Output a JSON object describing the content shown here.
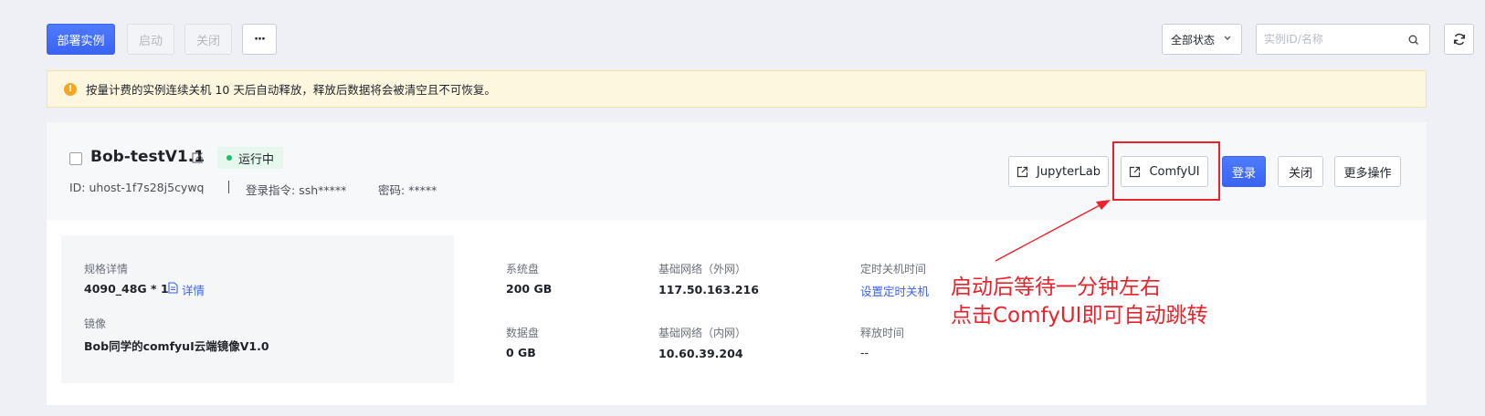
{
  "toolbar": {
    "deploy_label": "部署实例",
    "start_label": "启动",
    "close_label": "关闭",
    "more_label": "···",
    "status_select": "全部状态",
    "search_placeholder": "实例ID/名称"
  },
  "notice": {
    "text": "按量计费的实例连续关机 10 天后自动释放，释放后数据将会被清空且不可恢复。"
  },
  "instance": {
    "name": "Bob-testV1.1",
    "status": "运行中",
    "id": "ID: uhost-1f7s28j5cywq",
    "login_cmd": "登录指令: ssh*****",
    "password": "密码: *****",
    "actions": {
      "jupyterlab": "JupyterLab",
      "comfyui": "ComfyUI",
      "login": "登录",
      "close": "关闭",
      "more": "更多操作"
    },
    "spec": {
      "spec_label": "规格详情",
      "spec_value": "4090_48G * 1",
      "detail_link": "详情",
      "image_label": "镜像",
      "image_value": "Bob同学的comfyuI云端镜像V1.0"
    },
    "disk": {
      "system_label": "系统盘",
      "system_value": "200 GB",
      "data_label": "数据盘",
      "data_value": "0 GB"
    },
    "network": {
      "external_label": "基础网络（外网）",
      "external_value": "117.50.163.216",
      "internal_label": "基础网络（内网）",
      "internal_value": "10.60.39.204"
    },
    "schedule": {
      "shutdown_label": "定时关机时间",
      "shutdown_link": "设置定时关机",
      "release_label": "释放时间",
      "release_value": "--"
    }
  },
  "annotation": {
    "line1": "启动后等待一分钟左右",
    "line2": "点击ComfyUI即可自动跳转"
  },
  "colors": {
    "primary": "#3a63f2",
    "running": "#1bbf6b",
    "annotation": "#e8232b",
    "notice_bg": "#fdf7df"
  }
}
